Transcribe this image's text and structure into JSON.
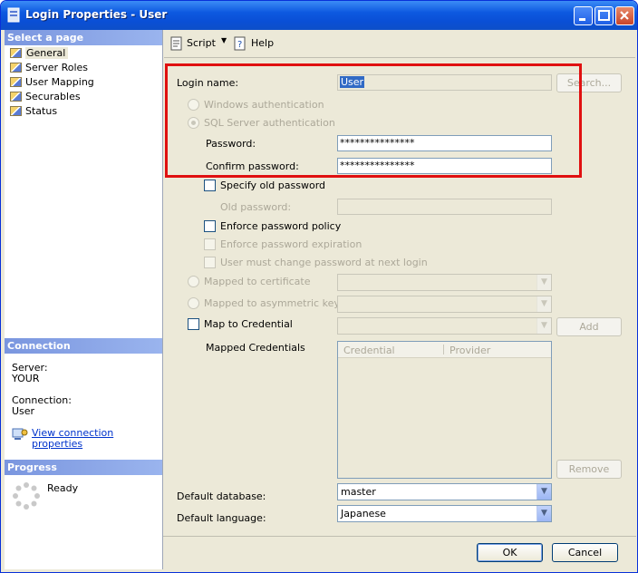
{
  "window": {
    "title": "Login Properties - User",
    "controls": [
      "minimize-icon",
      "maximize-icon",
      "close-icon"
    ]
  },
  "sidebar": {
    "select_page_header": "Select a page",
    "items": [
      {
        "label": "General",
        "selected": true,
        "icon": "page-icon"
      },
      {
        "label": "Server Roles",
        "icon": "page-icon"
      },
      {
        "label": "User Mapping",
        "icon": "page-icon"
      },
      {
        "label": "Securables",
        "icon": "page-icon"
      },
      {
        "label": "Status",
        "icon": "page-icon"
      }
    ],
    "connection_header": "Connection",
    "server_label": "Server:",
    "server_value": "YOUR",
    "connection_label": "Connection:",
    "connection_value": "User",
    "view_connection_line1": "View connection",
    "view_connection_line2": "properties",
    "progress_header": "Progress",
    "progress_status": "Ready"
  },
  "toolbar": {
    "script_label": "Script",
    "help_label": "Help"
  },
  "form": {
    "login_name_label": "Login name:",
    "login_name_value": "User",
    "search_button": "Search...",
    "windows_auth": "Windows authentication",
    "sql_auth": "SQL Server authentication",
    "password_label": "Password:",
    "password_value": "***************",
    "confirm_label": "Confirm password:",
    "confirm_value": "***************",
    "specify_old": "Specify old password",
    "old_password_label": "Old password:",
    "enforce_policy": "Enforce password policy",
    "enforce_expiration": "Enforce password expiration",
    "must_change": "User must change password at next login",
    "mapped_certificate": "Mapped to certificate",
    "mapped_asym_key": "Mapped to asymmetric key",
    "map_credential": "Map to Credential",
    "add_button": "Add",
    "mapped_credentials_label": "Mapped Credentials",
    "grid_col_credential": "Credential",
    "grid_col_provider": "Provider",
    "remove_button": "Remove",
    "default_db_label": "Default database:",
    "default_db_value": "master",
    "default_lang_label": "Default language:",
    "default_lang_value": "Japanese"
  },
  "footer": {
    "ok_button": "OK",
    "cancel_button": "Cancel"
  }
}
